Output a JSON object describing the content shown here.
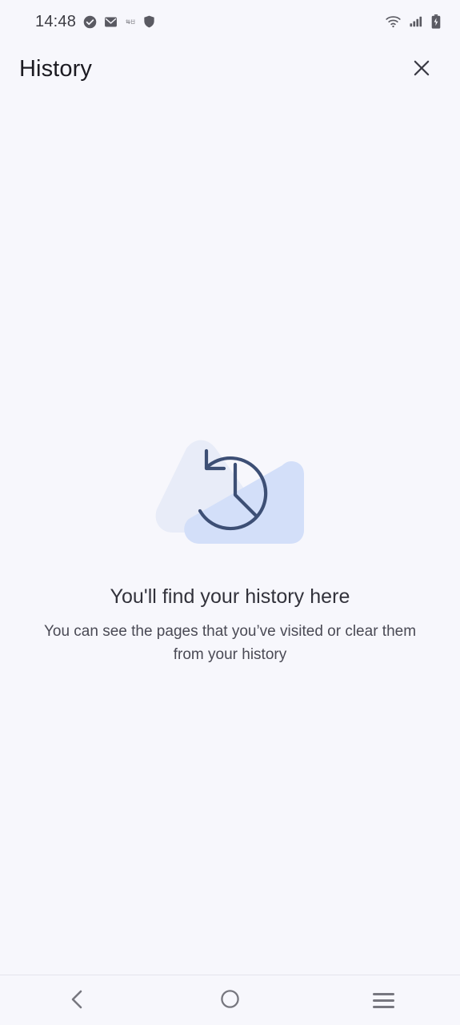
{
  "status_bar": {
    "time": "14:48",
    "left_icons": [
      {
        "name": "check-circle-icon",
        "label": "check-circle"
      },
      {
        "name": "mail-icon",
        "label": "mail"
      },
      {
        "name": "small-text-icon",
        "label": "每日"
      },
      {
        "name": "shield-icon",
        "label": "shield"
      }
    ],
    "right_icons": [
      {
        "name": "wifi-icon",
        "label": "wifi"
      },
      {
        "name": "cellular-signal-icon",
        "label": "cellular-signal"
      },
      {
        "name": "battery-charging-icon",
        "label": "battery-charging"
      }
    ]
  },
  "header": {
    "title": "History",
    "close_label": "close"
  },
  "empty_state": {
    "illustration_name": "history-clock-illustration",
    "title": "You'll find your history here",
    "description": "You can see the pages that you’ve visited or clear them from your history"
  },
  "nav_bar": {
    "back_label": "back",
    "home_label": "home",
    "recents_label": "recents"
  },
  "colors": {
    "page_background": "#f7f7fc",
    "title_text": "#1c1b22",
    "body_text": "#4a4a55",
    "illustration_blob_light": "#e8ecf8",
    "illustration_blob_blue": "#d3dff9",
    "illustration_stroke": "#3d4f75",
    "nav_icon": "#77777f",
    "status_icon": "#5a5a62"
  }
}
